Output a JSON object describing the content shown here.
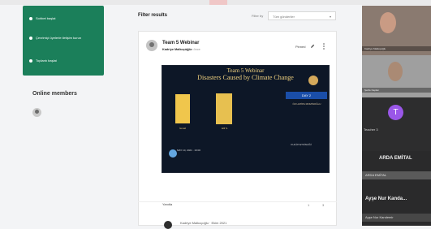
{
  "sidebar": {
    "items": [
      {
        "label": "Sohbet başlat"
      },
      {
        "label": "Çevrimiçi üyelerle iletişim kurun"
      },
      {
        "label": "Toplantı başlat"
      }
    ],
    "online_members_title": "Online members"
  },
  "feed": {
    "title": "Filter results",
    "filter_by_label": "Filter by",
    "filter_select_value": "Tüm gönderiler",
    "post": {
      "title": "Team 5 Webinar",
      "author": "Kadriye Malkoçoğlu",
      "time": "1 gün önce",
      "pinned_label": "Pinned",
      "poster_title": "Team 5 Webinar",
      "poster_subtitle": "Disasters Caused by Climate Change",
      "poster_dayband": "DAY 2",
      "poster_moderator": "ÖZ HATİPA MOMİNOĞLU",
      "poster_date": "MAY 10, 2021 · 19:00",
      "poster_schedule": "KULÜP ETKİNLİĞİ",
      "speaker1_caption": "İsmail",
      "speaker2_caption": "Elif S.",
      "reply_label": "Yanıtla",
      "likes_count": "1",
      "comments_count": "3",
      "comment_preview": "Kadriye Malkoçoğlu · Ekim 2021"
    }
  },
  "video_panel": {
    "tiles": [
      {
        "label": "Kadriye Malkoçoğlu"
      },
      {
        "label": "Şerife Kaplan"
      },
      {
        "label": "Teacher 3"
      },
      {
        "label": "ARDA EMİTAL"
      },
      {
        "label": "ARDA EMİTAL"
      },
      {
        "label": "Ayşe Nur Kandemir"
      }
    ],
    "arda_label": "ARDA EMİTAL",
    "ayse_label": "Ayşe Nur Kanda...",
    "tile_letter": "T"
  }
}
